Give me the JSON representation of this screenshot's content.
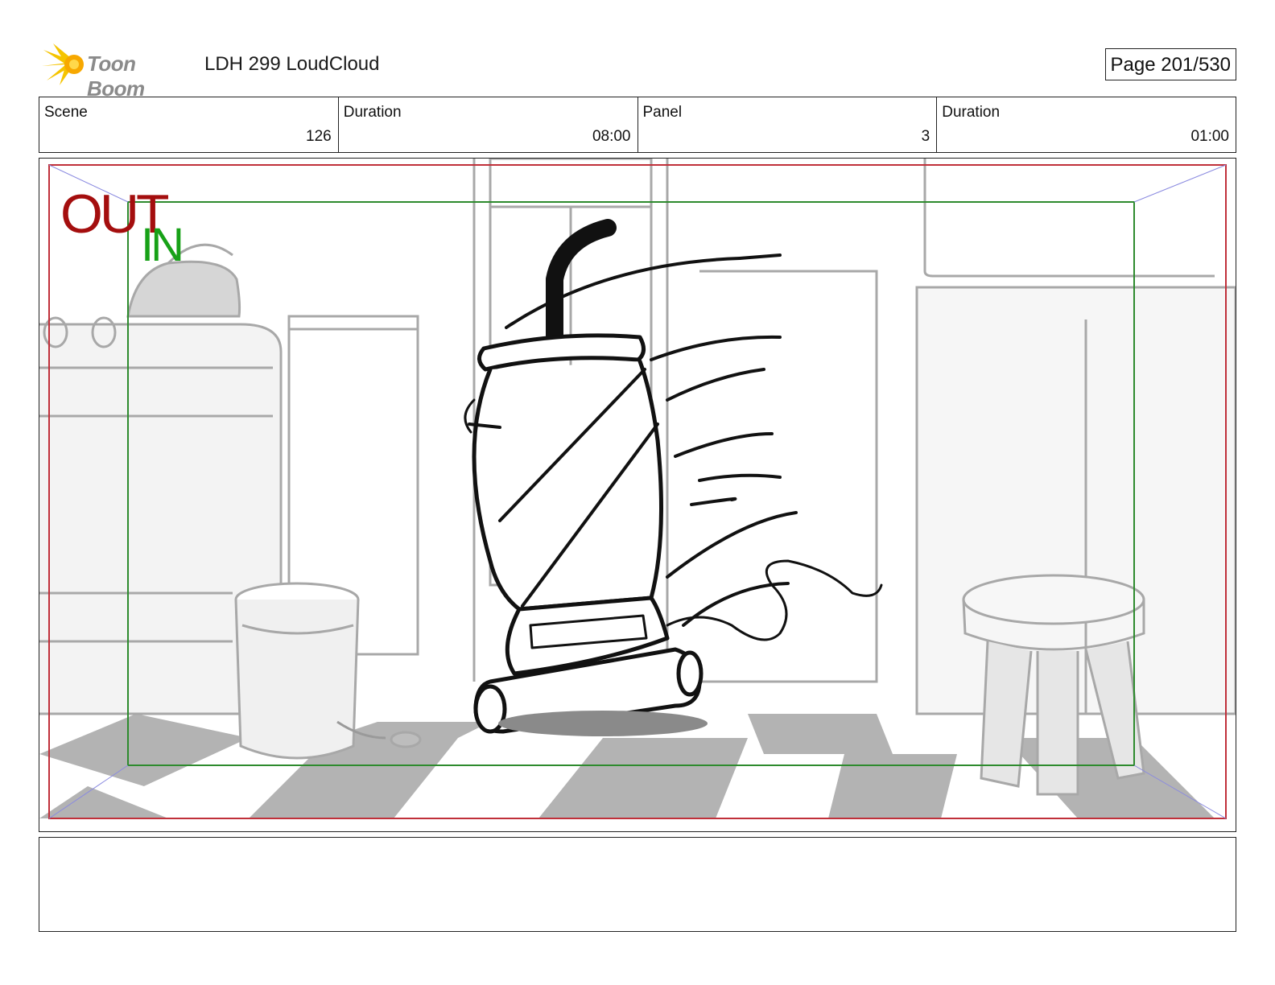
{
  "header": {
    "logo_text": "Toon Boom",
    "project_title": "LDH 299 LoudCloud",
    "page_indicator": "Page 201/530"
  },
  "info": [
    {
      "label": "Scene",
      "value": "126"
    },
    {
      "label": "Duration",
      "value": "08:00"
    },
    {
      "label": "Panel",
      "value": "3"
    },
    {
      "label": "Duration",
      "value": "01:00"
    }
  ],
  "frame": {
    "out_label": "OUT",
    "in_label": "IN",
    "out_color": "#a40e0e",
    "in_color": "#17a117",
    "out_frame_color": "#c0303a",
    "in_frame_color": "#2e8b2e"
  },
  "notes": {
    "text": ""
  }
}
